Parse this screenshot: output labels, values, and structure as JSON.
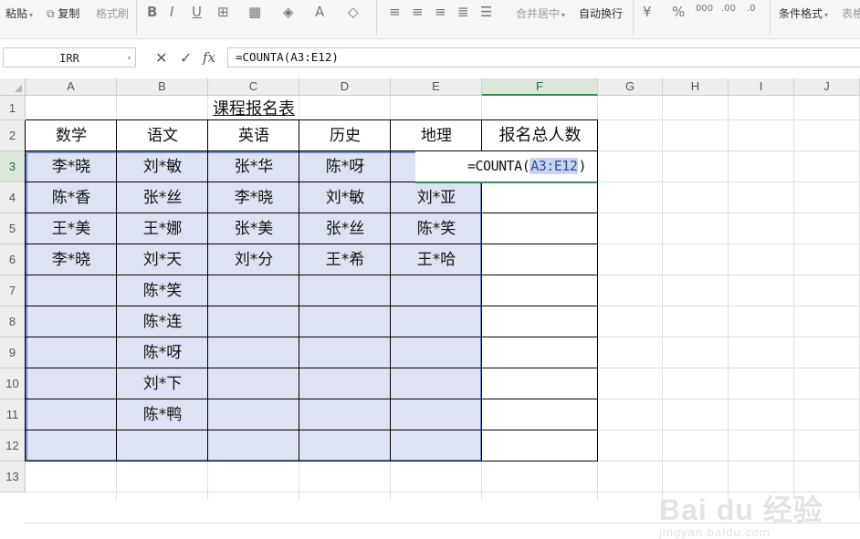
{
  "ribbon": {
    "paste": "粘贴",
    "copy": "复制",
    "format_painter": "格式刷",
    "merge_center": "合并居中",
    "wrap_text": "自动换行",
    "percent": "%",
    "conditional_format": "条件格式",
    "table_style": "表格"
  },
  "formula_bar": {
    "name_box": "IRR",
    "fx": "fx",
    "formula": "=COUNTA(A3:E12)"
  },
  "columns": [
    "A",
    "B",
    "C",
    "D",
    "E",
    "F",
    "G",
    "H",
    "I",
    "J"
  ],
  "rows": [
    "1",
    "2",
    "3",
    "4",
    "5",
    "6",
    "7",
    "8",
    "9",
    "10",
    "11",
    "12",
    "13"
  ],
  "sheet": {
    "title": "课程报名表",
    "headers": [
      "数学",
      "语文",
      "英语",
      "历史",
      "地理",
      "报名总人数"
    ],
    "data": [
      [
        "李*晓",
        "刘*敏",
        "张*华",
        "陈*呀",
        ""
      ],
      [
        "陈*香",
        "张*丝",
        "李*晓",
        "刘*敏",
        "刘*亚"
      ],
      [
        "王*美",
        "王*娜",
        "张*美",
        "张*丝",
        "陈*笑"
      ],
      [
        "李*晓",
        "刘*天",
        "刘*分",
        "王*希",
        "王*哈"
      ],
      [
        "",
        "陈*笑",
        "",
        "",
        ""
      ],
      [
        "",
        "陈*连",
        "",
        "",
        ""
      ],
      [
        "",
        "陈*呀",
        "",
        "",
        ""
      ],
      [
        "",
        "刘*下",
        "",
        "",
        ""
      ],
      [
        "",
        "陈*鸭",
        "",
        "",
        ""
      ],
      [
        "",
        "",
        "",
        "",
        ""
      ]
    ],
    "editing_formula_prefix": "=COUNTA(",
    "editing_formula_ref": "A3:E12",
    "editing_formula_suffix": ")"
  },
  "selection": {
    "active_column": "F",
    "active_row": "3",
    "range": "A3:E12"
  },
  "watermark": {
    "main": "Bai du 经验",
    "sub": "jingyan.baidu.com"
  },
  "colors": {
    "range_fill": "#dde3f3",
    "range_border": "#6a86c8",
    "active_header": "#217346"
  }
}
